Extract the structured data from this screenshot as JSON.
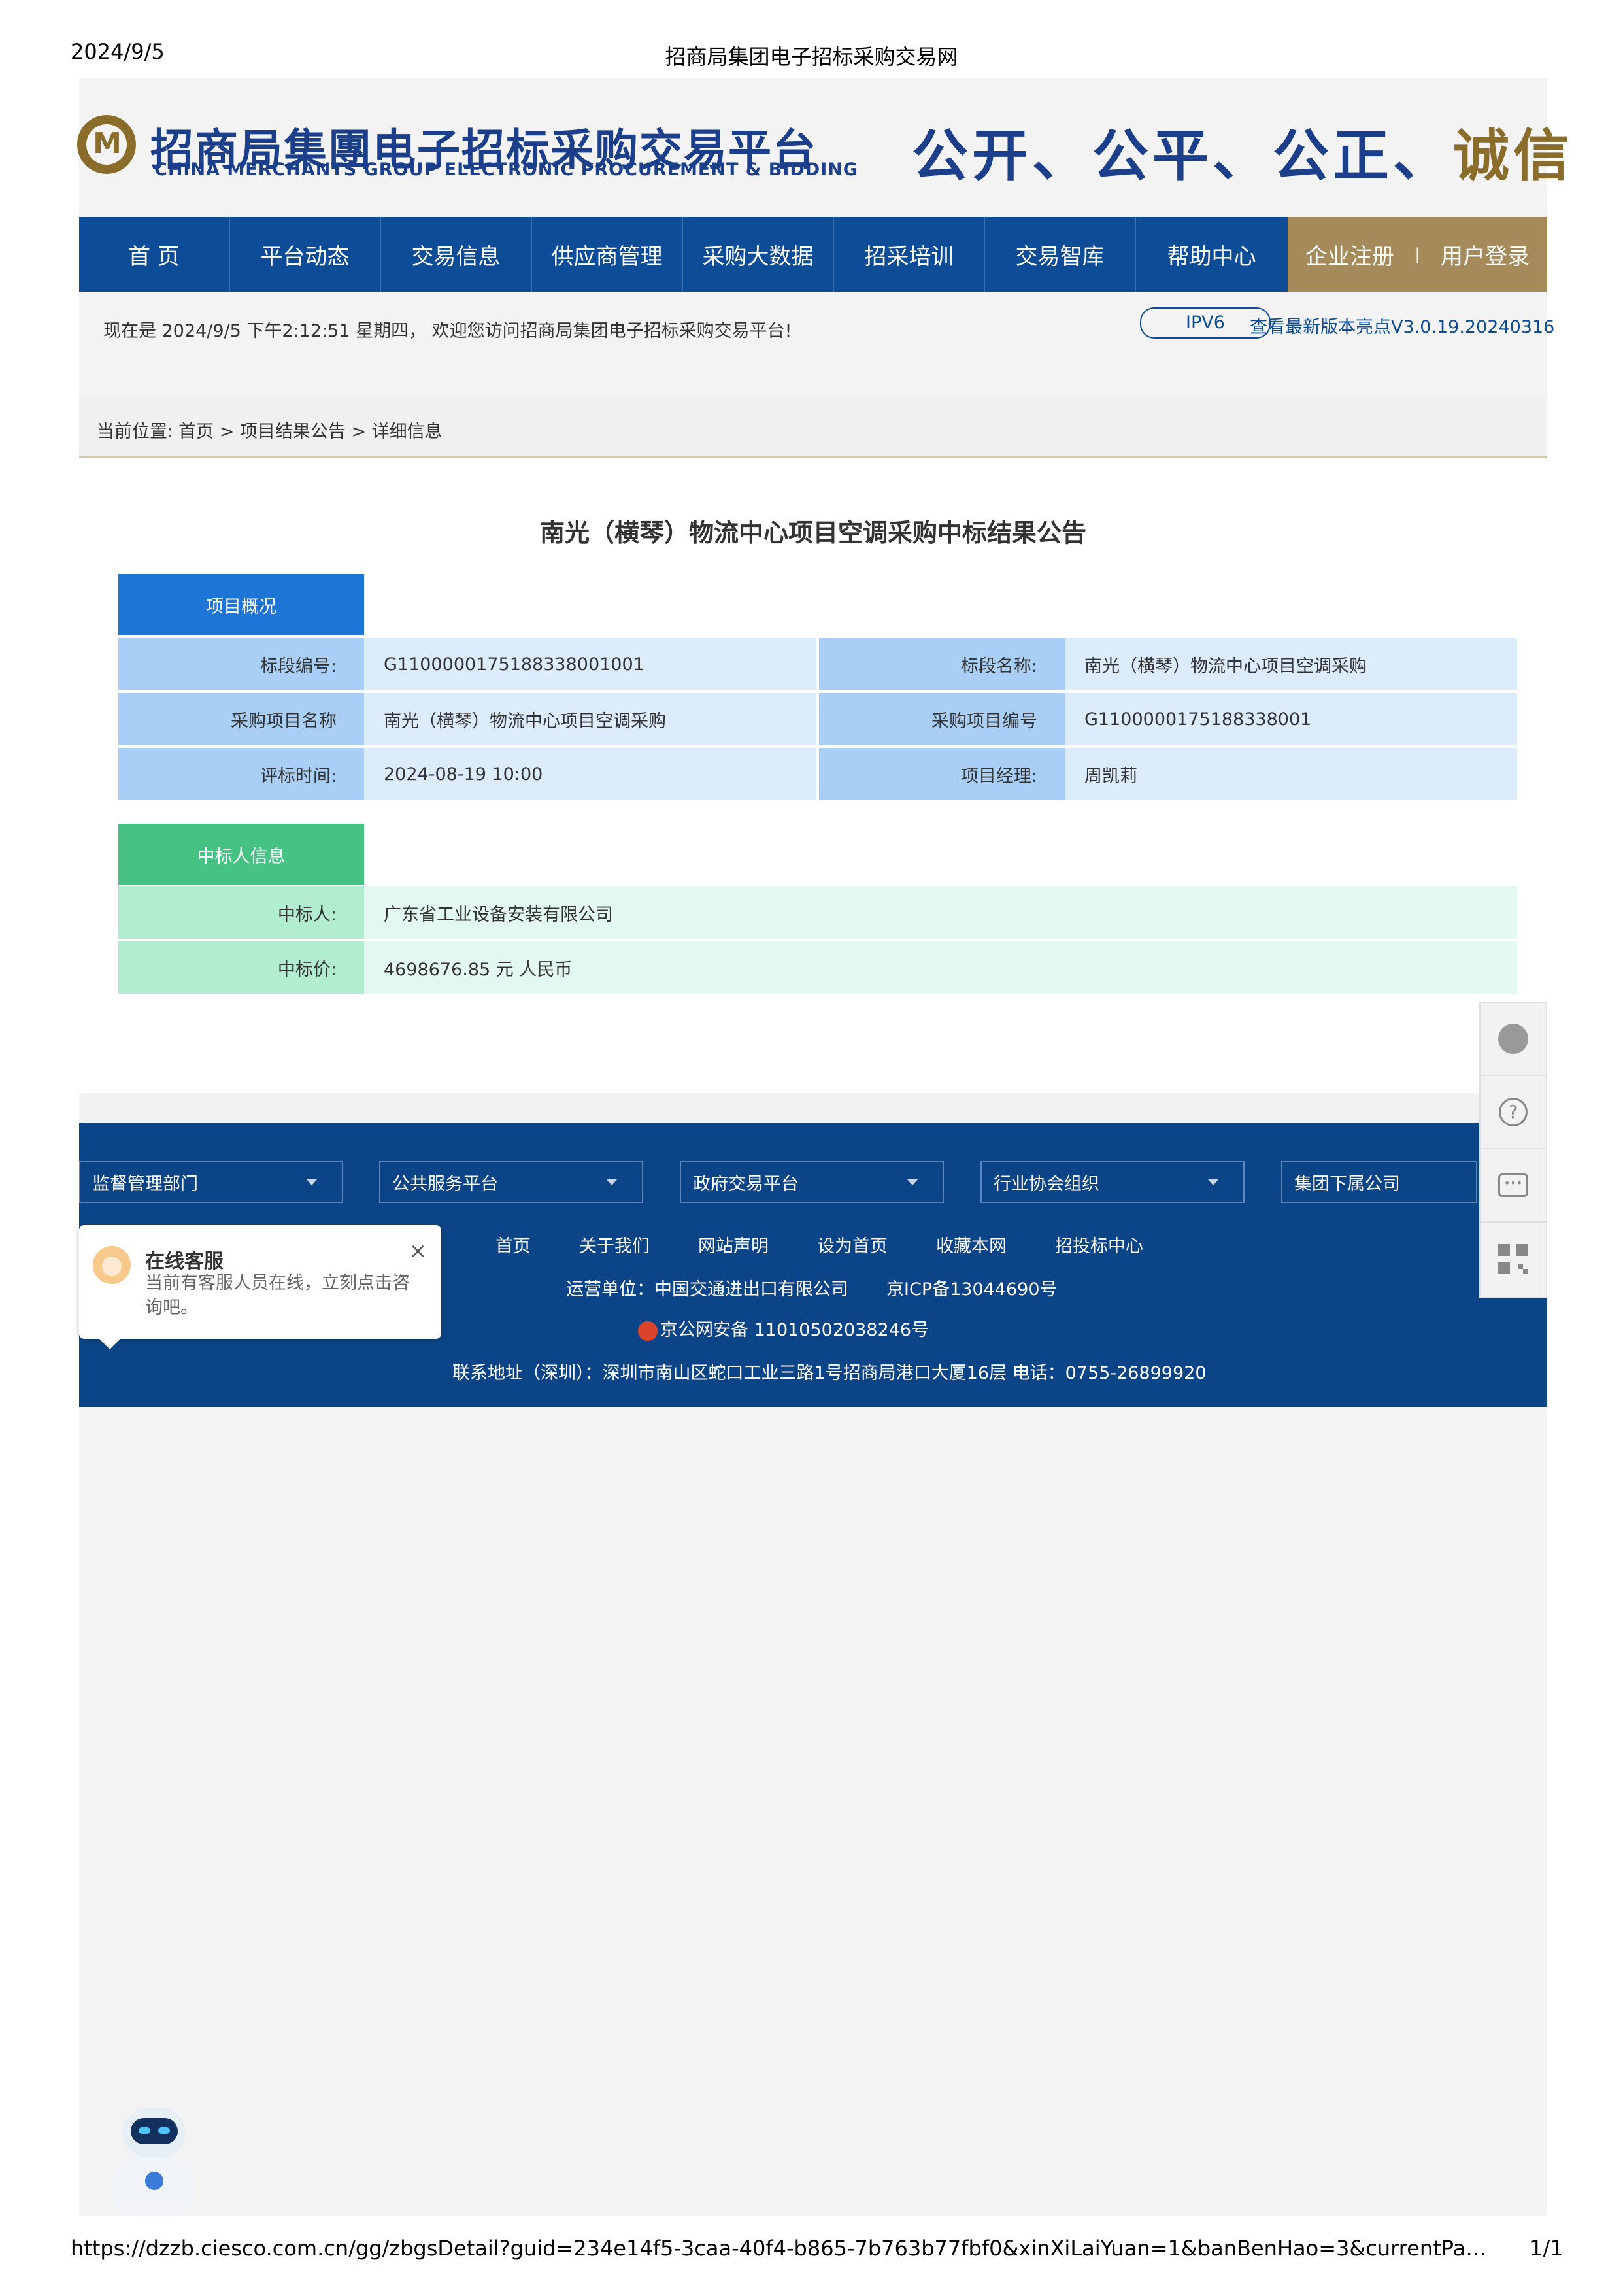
{
  "print": {
    "date": "2024/9/5",
    "title": "招商局集团电子招标采购交易网",
    "url": "https://dzzb.ciesco.com.cn/gg/zbgsDetail?guid=234e14f5-3caa-40f4-b865-7b763b77fbf0&xinXiLaiYuan=1&banBenHao=3&currentPage=1&token…",
    "page": "1/1"
  },
  "header": {
    "logo_cn": "招商局集團电子招标采购交易平台",
    "logo_en": "CHINA MERCHANTS GROUP ELECTRONIC PROCUREMENT & BIDDING",
    "slogan_a": "公开、公平、公正、",
    "slogan_b": "诚信"
  },
  "nav": {
    "items": [
      "首 页",
      "平台动态",
      "交易信息",
      "供应商管理",
      "采购大数据",
      "招采培训",
      "交易智库",
      "帮助中心"
    ],
    "register": "企业注册",
    "separator": "|",
    "login": "用户登录"
  },
  "welcome": {
    "text": "现在是 2024/9/5 下午2:12:51 星期四， 欢迎您访问招商局集团电子招标采购交易平台!",
    "ipv6": "IPV6",
    "version": "查看最新版本亮点V3.0.19.20240316"
  },
  "breadcrumb": {
    "label": "当前位置:",
    "path": "首页 > 项目结果公告 > 详细信息"
  },
  "notice": {
    "title": "南光（横琴）物流中心项目空调采购中标结果公告",
    "section1": "项目概况",
    "rows": [
      {
        "l1": "标段编号:",
        "v1": "G1100000175188338001001",
        "l2": "标段名称:",
        "v2": "南光（横琴）物流中心项目空调采购"
      },
      {
        "l1": "采购项目名称",
        "v1": "南光（横琴）物流中心项目空调采购",
        "l2": "采购项目编号",
        "v2": "G1100000175188338001"
      },
      {
        "l1": "评标时间:",
        "v1": "2024-08-19 10:00",
        "l2": "项目经理:",
        "v2": "周凯莉"
      }
    ],
    "section2": "中标人信息",
    "winner_label": "中标人:",
    "winner": "广东省工业设备安装有限公司",
    "price_label": "中标价:",
    "price": "4698676.85 元 人民币"
  },
  "footer": {
    "dropdowns": [
      "监督管理部门",
      "公共服务平台",
      "政府交易平台",
      "行业协会组织",
      "集团下属公司"
    ],
    "links": [
      "首页",
      "关于我们",
      "网站声明",
      "设为首页",
      "收藏本网",
      "招投标中心"
    ],
    "operator": "运营单位：中国交通进出口有限公司",
    "icp": "京ICP备13044690号",
    "police": "京公网安备 11010502038246号",
    "address": "联系地址（深圳）：深圳市南山区蛇口工业三路1号招商局港口大厦16层  电话：0755-26899920"
  },
  "popup": {
    "title": "在线客服",
    "desc": "当前有客服人员在线，立刻点击咨询吧。",
    "close": "×"
  },
  "float": {
    "help_glyph": "?",
    "chat_glyph": "•••"
  }
}
